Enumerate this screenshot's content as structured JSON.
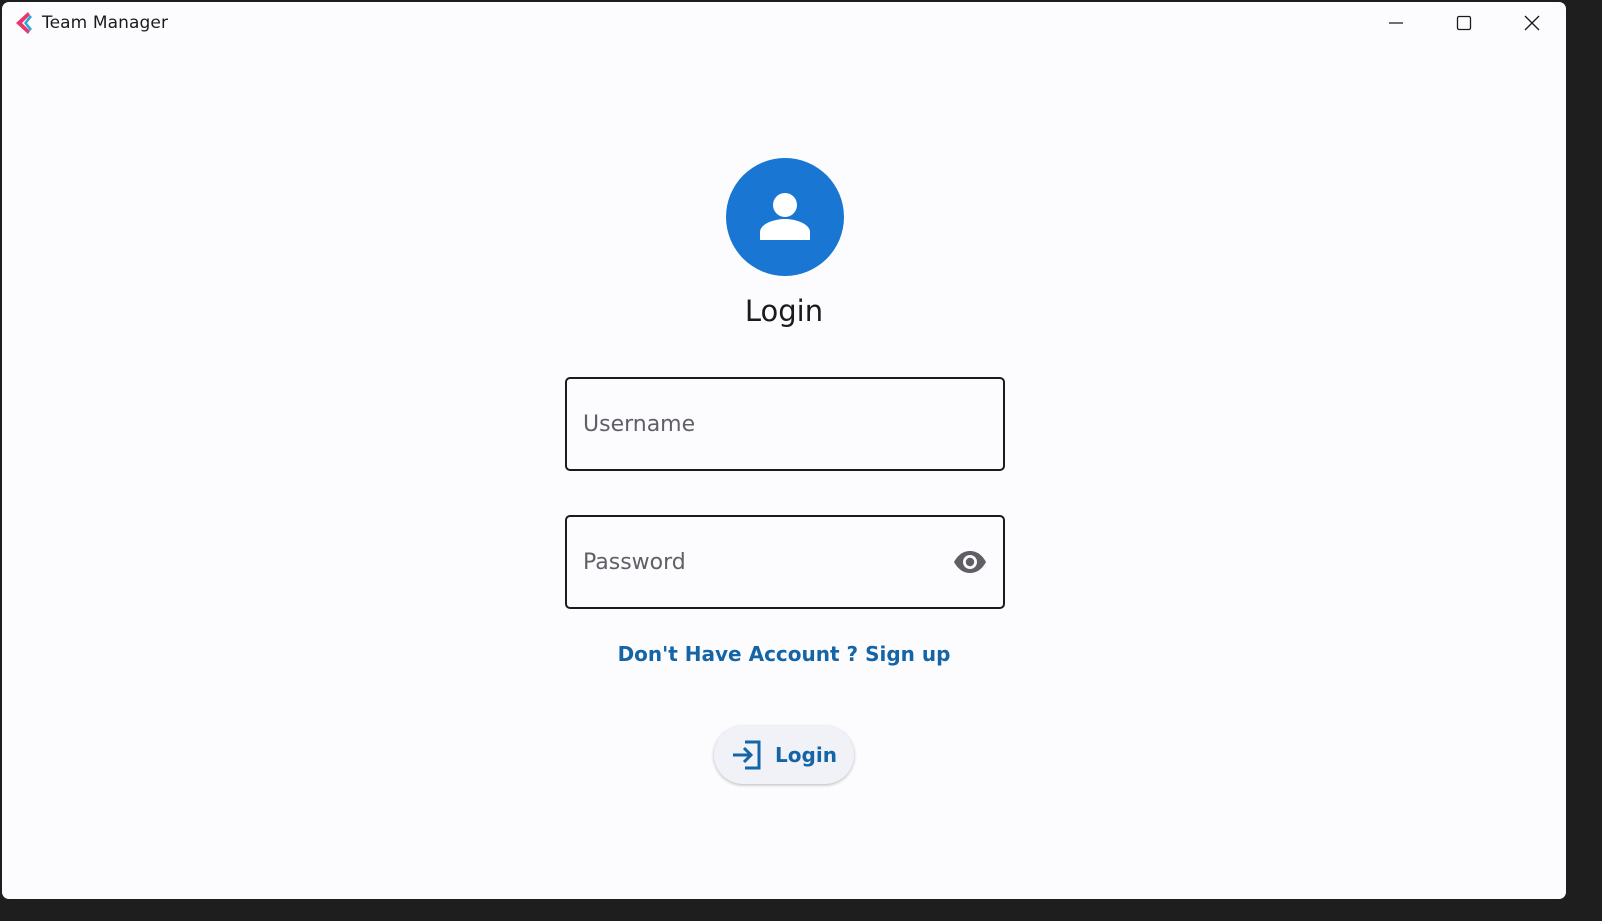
{
  "window": {
    "title": "Team Manager",
    "controls": [
      "minimize",
      "maximize",
      "close"
    ]
  },
  "login": {
    "heading": "Login",
    "avatar_icon": "person-icon",
    "username": {
      "placeholder": "Username",
      "value": ""
    },
    "password": {
      "placeholder": "Password",
      "value": "",
      "toggle_icon": "eye-icon"
    },
    "signup_link": "Don't Have Account ? Sign up",
    "submit_label": "Login",
    "submit_icon": "login-arrow-icon"
  },
  "colors": {
    "accent": "#1976d2",
    "link": "#1565a6",
    "background": "#fcfcff",
    "text": "#1b1b1f"
  }
}
